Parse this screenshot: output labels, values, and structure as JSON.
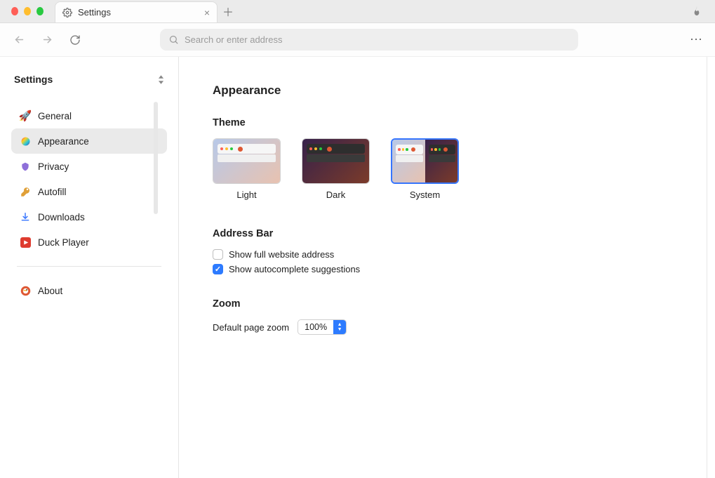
{
  "tab": {
    "title": "Settings"
  },
  "address": {
    "placeholder": "Search or enter address"
  },
  "sidebar": {
    "title": "Settings",
    "items": [
      {
        "label": "General"
      },
      {
        "label": "Appearance"
      },
      {
        "label": "Privacy"
      },
      {
        "label": "Autofill"
      },
      {
        "label": "Downloads"
      },
      {
        "label": "Duck Player"
      }
    ],
    "about_label": "About"
  },
  "page": {
    "title": "Appearance",
    "theme": {
      "heading": "Theme",
      "light": "Light",
      "dark": "Dark",
      "system": "System"
    },
    "address_bar": {
      "heading": "Address Bar",
      "show_full": "Show full website address",
      "show_autocomplete": "Show autocomplete suggestions"
    },
    "zoom": {
      "heading": "Zoom",
      "label": "Default page zoom",
      "value": "100%"
    }
  }
}
